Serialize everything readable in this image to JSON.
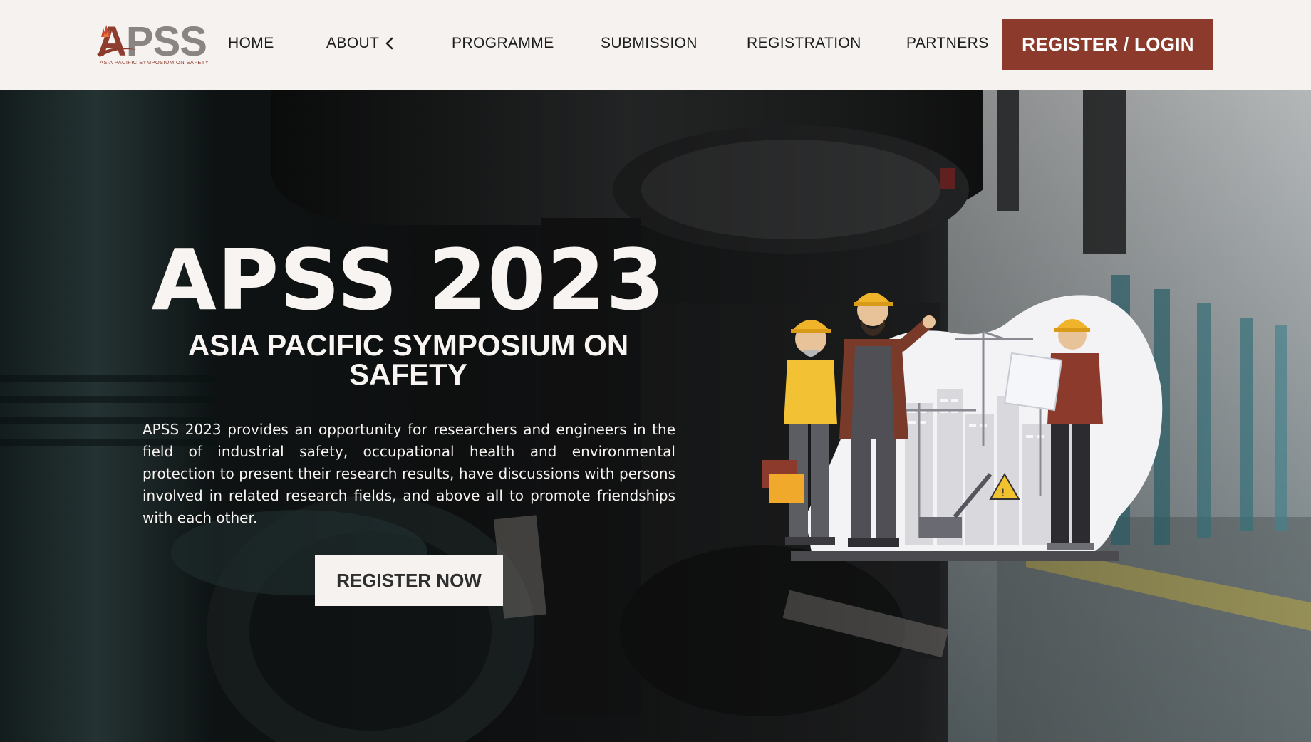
{
  "logo": {
    "word_a": "A",
    "word_rest": "PSS",
    "tagline": "ASIA PACIFIC SYMPOSIUM ON SAFETY",
    "brand_color": "#8c3a2c"
  },
  "nav": {
    "items": [
      {
        "label": "HOME"
      },
      {
        "label": "ABOUT",
        "icon": "chevron-left-icon"
      },
      {
        "label": "PROGRAMME"
      },
      {
        "label": "SUBMISSION"
      },
      {
        "label": "REGISTRATION"
      },
      {
        "label": "PARTNERS"
      }
    ],
    "login_label": "REGISTER / LOGIN"
  },
  "hero": {
    "title": "APSS 2023",
    "subtitle": "ASIA PACIFIC SYMPOSIUM ON SAFETY",
    "description": "APSS 2023 provides an opportunity for researchers and engineers in the field of industrial safety, occupational health and environmental protection to present their research results, have discussions with persons involved in related research fields, and above all to promote friendships with each other.",
    "cta_label": "REGISTER NOW",
    "background": "industrial-pipes-photo",
    "illustration": "construction-workers-illustration"
  },
  "colors": {
    "nav_bg": "#f5f2ef",
    "accent": "#8c3a2c",
    "hero_text": "#f7f4f1"
  }
}
